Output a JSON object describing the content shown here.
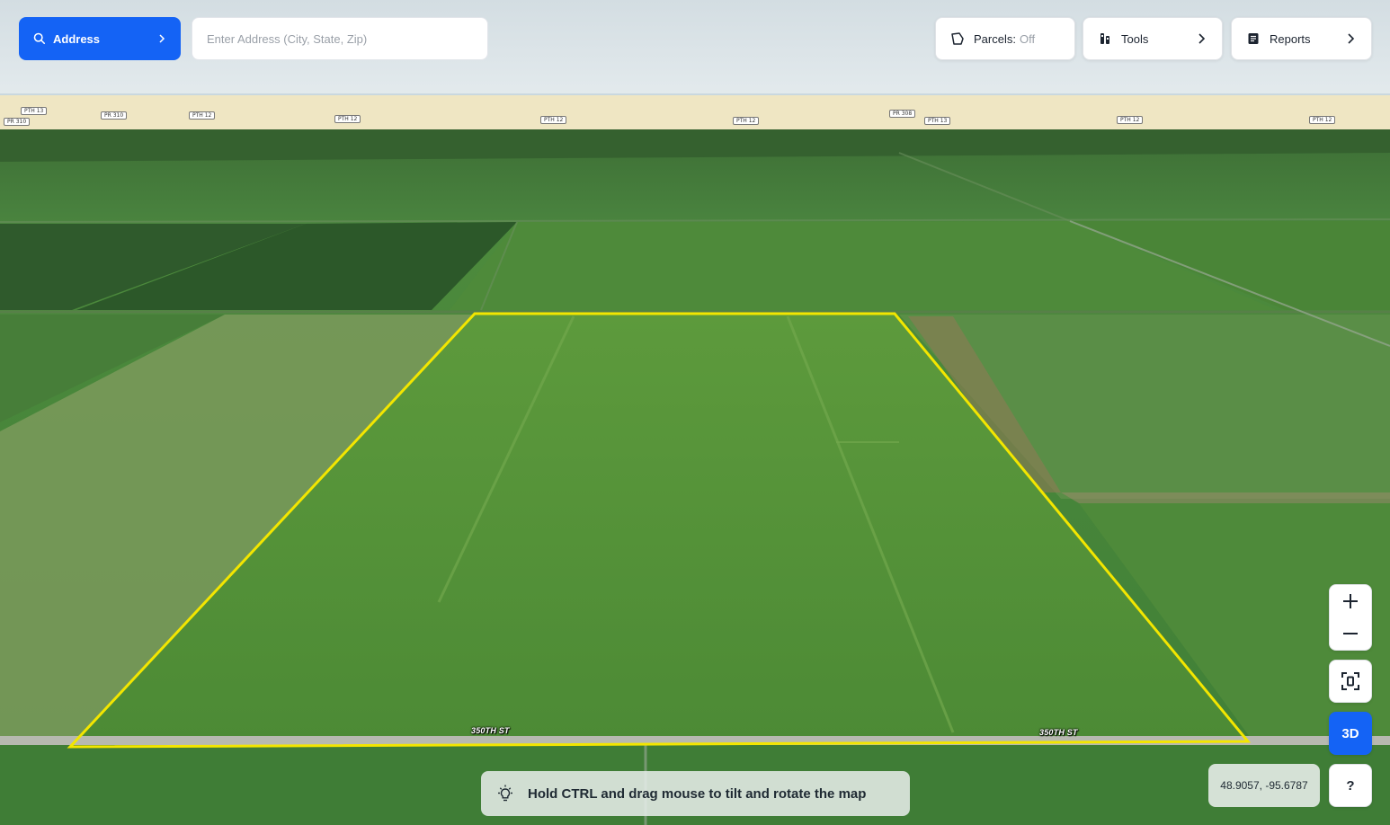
{
  "colors": {
    "accent": "#1463f5",
    "parcel_outline": "#f3e600",
    "text_dark": "#1c2430",
    "muted": "#9aa0a8"
  },
  "toolbar": {
    "address_label": "Address",
    "address_icon": "search-icon",
    "search_placeholder": "Enter Address (City, State, Zip)",
    "parcels_label": "Parcels:",
    "parcels_state": "Off",
    "tools_label": "Tools",
    "reports_label": "Reports"
  },
  "map": {
    "route_shields": [
      "PTH 13",
      "PR 310",
      "PR 310",
      "PTH 12",
      "PTH 12",
      "PTH 12",
      "PTH 12",
      "PR 308",
      "PTH 13",
      "PTH 12",
      "PTH 12"
    ],
    "road_labels": [
      "350TH ST",
      "350TH ST"
    ],
    "tip_text": "Hold CTRL and drag mouse to tilt and rotate the map",
    "tip_icon": "lightbulb-icon",
    "coordinates": "48.9057, -95.6787"
  },
  "controls": {
    "zoom_in": "+",
    "zoom_out": "−",
    "view_3d": "3D",
    "help": "?"
  }
}
